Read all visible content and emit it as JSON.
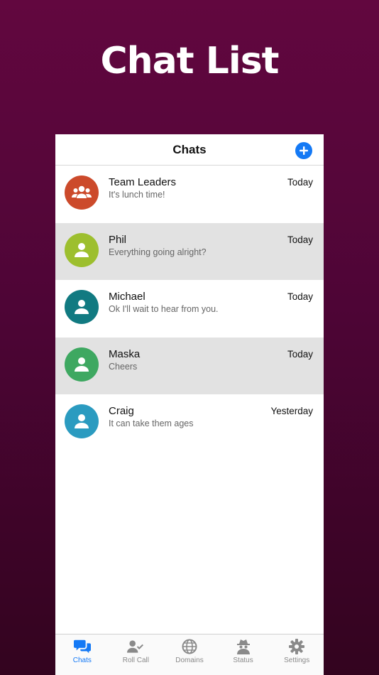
{
  "promo": {
    "title": "Chat List"
  },
  "navbar": {
    "title": "Chats",
    "add_icon": "plus-circle-icon",
    "accent": "#1479f5"
  },
  "chats": [
    {
      "name": "Team Leaders",
      "message": "It's lunch time!",
      "time": "Today",
      "avatar_color": "#cc4a2b",
      "avatar_icon": "group-icon"
    },
    {
      "name": "Phil",
      "message": "Everything going alright?",
      "time": "Today",
      "avatar_color": "#9dbf2e",
      "avatar_icon": "user-icon"
    },
    {
      "name": "Michael",
      "message": "Ok I'll wait to hear from you.",
      "time": "Today",
      "avatar_color": "#117a81",
      "avatar_icon": "user-icon"
    },
    {
      "name": "Maska",
      "message": "Cheers",
      "time": "Today",
      "avatar_color": "#3ea861",
      "avatar_icon": "user-icon"
    },
    {
      "name": "Craig",
      "message": "It can take them ages",
      "time": "Yesterday",
      "avatar_color": "#2b9bc0",
      "avatar_icon": "user-icon"
    }
  ],
  "tabbar": {
    "tabs": [
      {
        "label": "Chats",
        "icon": "chat-bubbles-icon",
        "active": true
      },
      {
        "label": "Roll Call",
        "icon": "user-check-icon",
        "active": false
      },
      {
        "label": "Domains",
        "icon": "globe-icon",
        "active": false
      },
      {
        "label": "Status",
        "icon": "spy-icon",
        "active": false
      },
      {
        "label": "Settings",
        "icon": "gear-icon",
        "active": false
      }
    ]
  }
}
